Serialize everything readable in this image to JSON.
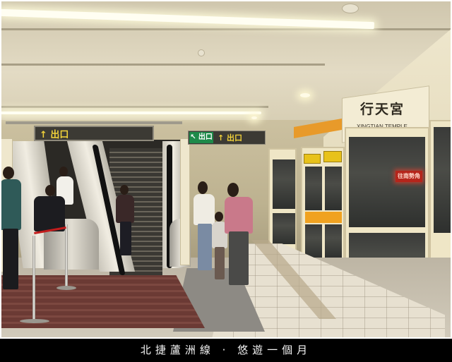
{
  "photo": {
    "station_name_cn": "行天宮",
    "station_name_en": "XINGTIAN TEMPLE",
    "exit_sign": "↑ 出口",
    "direction_sign_green": "↖ 出口",
    "direction_sign_yellow": "↑ 出口",
    "train_display": "往南勢角",
    "door_sign_left": "↑",
    "door_sign_right": "↑"
  },
  "caption": {
    "text": "北捷蘆洲線 · 悠遊一個月"
  },
  "colors": {
    "accent_orange": "#e89a2a",
    "door_yellow": "#e8c21a",
    "sign_green": "#1e8a4a",
    "caption_bg": "#000000"
  }
}
